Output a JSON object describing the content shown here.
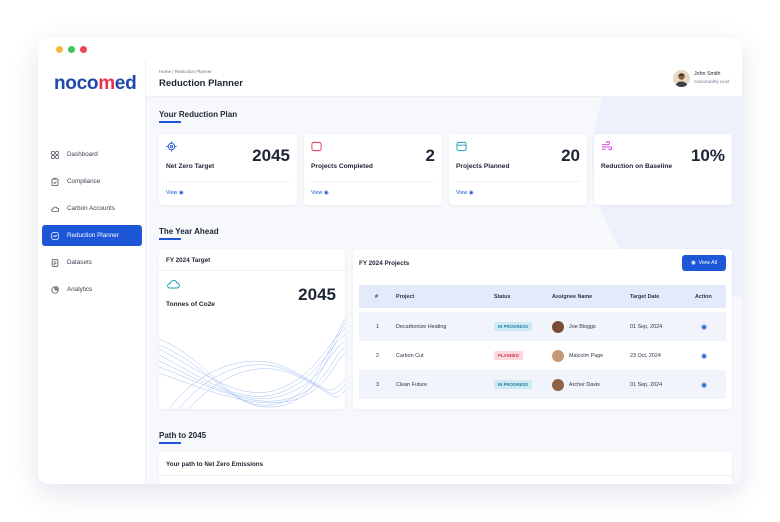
{
  "window": {
    "controls": [
      "close",
      "minimize",
      "maximize"
    ],
    "control_colors": [
      "#f6b73c",
      "#3dc45c",
      "#ea4459"
    ]
  },
  "brand": {
    "part1": "noco",
    "part2": "m",
    "part3": "ed"
  },
  "sidebar": {
    "items": [
      {
        "label": "Dashboard",
        "icon": "grid-icon",
        "active": false
      },
      {
        "label": "Compliance",
        "icon": "clipboard-check-icon",
        "active": false
      },
      {
        "label": "Carbon Accounts",
        "icon": "cloud-icon",
        "active": false
      },
      {
        "label": "Reduction Planner",
        "icon": "planner-icon",
        "active": true
      },
      {
        "label": "Datasets",
        "icon": "document-icon",
        "active": false
      },
      {
        "label": "Analytics",
        "icon": "pie-chart-icon",
        "active": false
      }
    ]
  },
  "header": {
    "breadcrumb": "Home / Reduction Planner",
    "title": "Reduction Planner",
    "user": {
      "name": "John Smith",
      "role": "Sustainability Lead"
    }
  },
  "plan": {
    "title": "Your Reduction Plan",
    "cards": [
      {
        "label": "Net Zero Target",
        "value": "2045",
        "link": "View",
        "icon": "target-icon",
        "icon_color": "#1e56d8"
      },
      {
        "label": "Projects Completed",
        "value": "2",
        "link": "View",
        "icon": "folder-icon",
        "icon_color": "#e5334d"
      },
      {
        "label": "Projects Planned",
        "value": "20",
        "link": "View",
        "icon": "folder-icon",
        "icon_color": "#1d9fb3"
      },
      {
        "label": "Reduction on Baseline",
        "value": "10%",
        "icon": "wind-icon",
        "icon_color": "#d23ad6"
      }
    ]
  },
  "year": {
    "title": "The Year Ahead",
    "target": {
      "heading": "FY 2024 Target",
      "label": "Tonnes of Co2e",
      "value": "2045",
      "icon": "cloud-icon"
    },
    "projects": {
      "heading": "FY 2024 Projects",
      "view_all": "View All",
      "columns": [
        "#",
        "Project",
        "Status",
        "Assignee Name",
        "Target Date",
        "Action"
      ],
      "rows": [
        {
          "num": "1",
          "project": "Decarbonize Heating",
          "status": "IN PROGRESS",
          "status_type": "prog",
          "assignee": "Joe Bloggs",
          "date": "01 Sep, 2024"
        },
        {
          "num": "2",
          "project": "Carbon Cut",
          "status": "PLANNED",
          "status_type": "plan",
          "assignee": "Malcolm Page",
          "date": "23 Oct, 2024"
        },
        {
          "num": "3",
          "project": "Clean Future",
          "status": "IN PROGRESS",
          "status_type": "prog",
          "assignee": "Archer Davis",
          "date": "01 Sep, 2024"
        }
      ]
    }
  },
  "path": {
    "title": "Path to 2045",
    "subtitle": "Your path to Net Zero Emissions"
  },
  "colors": {
    "accent": "#1e56d8",
    "brand_blue": "#1f4aa8",
    "brand_red": "#e5334d",
    "page_bg": "#f6f8fc"
  }
}
